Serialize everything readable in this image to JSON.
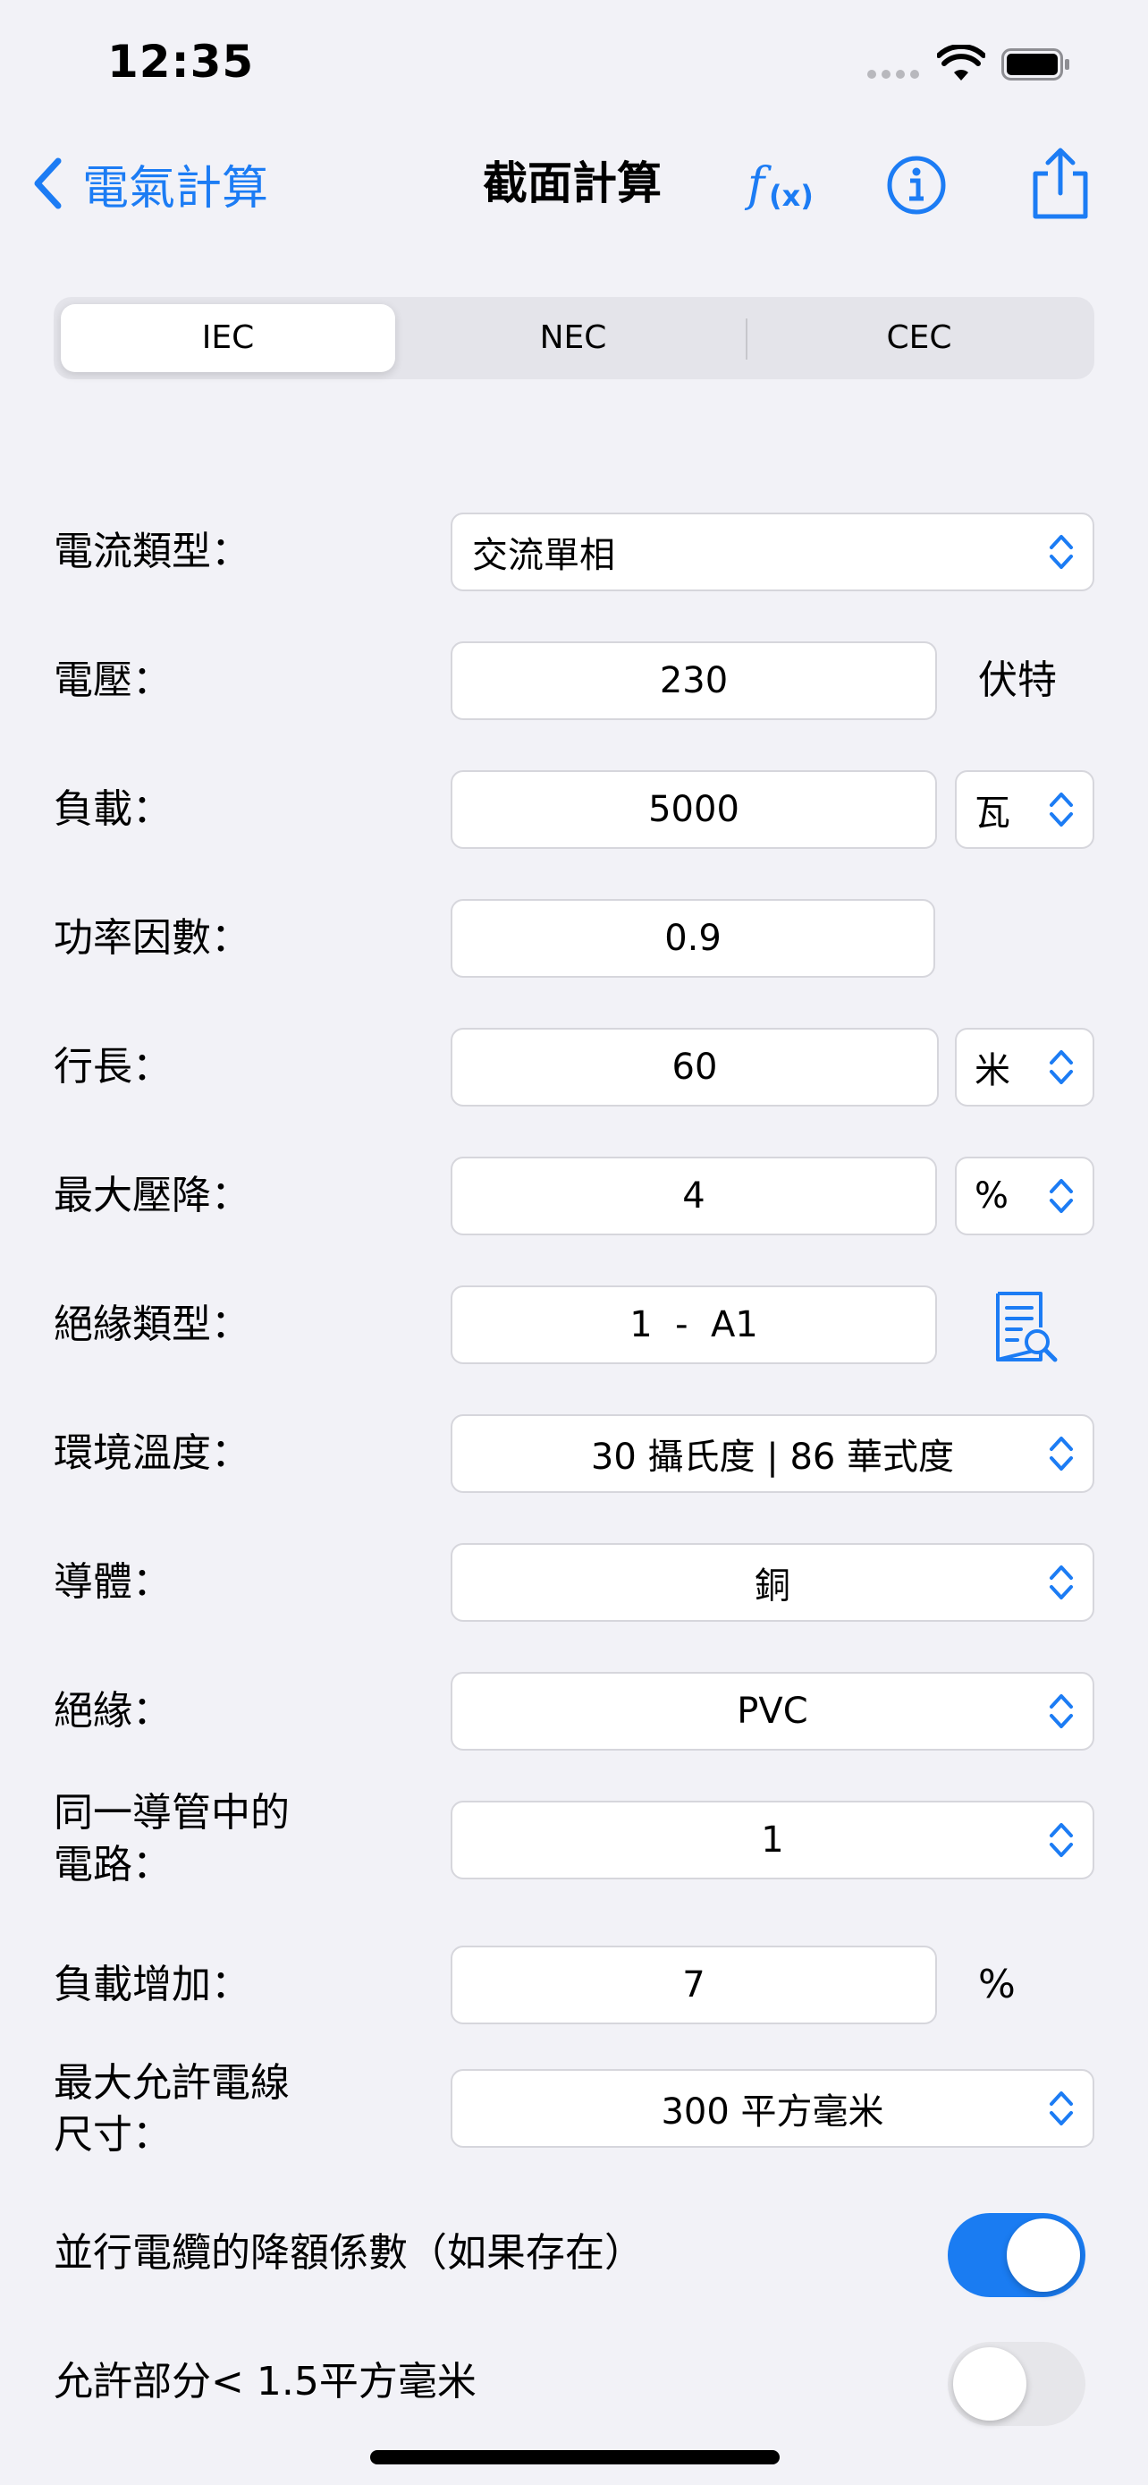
{
  "status_bar": {
    "time": "12:35"
  },
  "nav": {
    "back_label": "電氣計算",
    "title": "截面計算"
  },
  "segments": [
    "IEC",
    "NEC",
    "CEC"
  ],
  "selected_segment": "IEC",
  "form": {
    "current_type": {
      "label": "電流類型：",
      "value": "交流單相"
    },
    "voltage": {
      "label": "電壓：",
      "value": "230",
      "unit": "伏特"
    },
    "load": {
      "label": "負載：",
      "value": "5000",
      "unit": "瓦"
    },
    "power_factor": {
      "label": "功率因數：",
      "value": "0.9"
    },
    "length": {
      "label": "行長：",
      "value": "60",
      "unit": "米"
    },
    "max_voltage_drop": {
      "label": "最大壓降：",
      "value": "4",
      "unit": "%"
    },
    "insulation_type": {
      "label": "絕緣類型：",
      "value": "1  -  A1"
    },
    "ambient_temp": {
      "label": "環境溫度：",
      "value": "30 攝氏度 | 86 華式度"
    },
    "conductor": {
      "label": "導體：",
      "value": "銅"
    },
    "insulation": {
      "label": "絕緣：",
      "value": "PVC"
    },
    "circuits": {
      "label": "同一導管中的\n電路：",
      "value": "1"
    },
    "load_increase": {
      "label": "負載增加：",
      "value": "7",
      "unit": "%"
    },
    "max_wire_size": {
      "label": "最大允許電線\n尺寸：",
      "value": "300 平方毫米"
    }
  },
  "toggles": {
    "derating": {
      "label": "並行電纜的降額係數（如果存在）",
      "on": true
    },
    "allow_small": {
      "label": "允許部分< 1.5平方毫米",
      "on": false
    }
  },
  "colors": {
    "accent": "#1c7cf4",
    "background": "#f2f2f7",
    "toggle_on": "#1a7cf2",
    "toggle_off": "#e6e6ea"
  }
}
